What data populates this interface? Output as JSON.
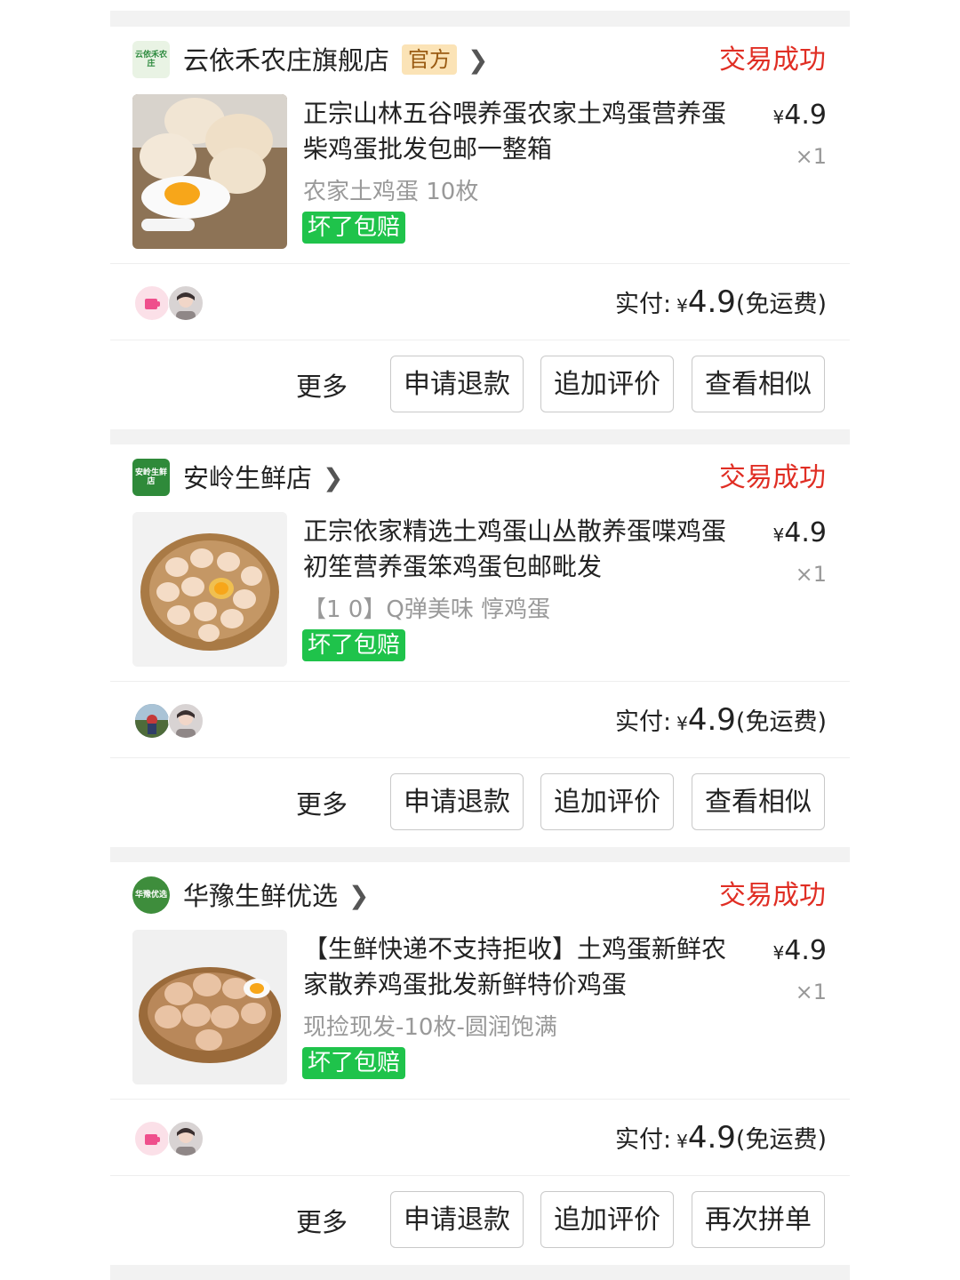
{
  "orders": [
    {
      "shop": {
        "name": "云依禾农庄旗舰店",
        "badge": "官方",
        "logo_text": "云依禾农庄",
        "logo_color": "#e9f3e4",
        "logo_text_color": "#2d8a3e"
      },
      "status": "交易成功",
      "title": "正宗山林五谷喂养蛋农家土鸡蛋营养蛋柴鸡蛋批发包邮一整箱",
      "spec": "农家土鸡蛋 10枚",
      "guarantee": "坏了包赔",
      "price_symbol": "¥",
      "price": "4.9",
      "qty": "×1",
      "paid_label": "实付:",
      "paid_symbol": "¥",
      "paid_amount": "4.9",
      "shipping": "(免运费)",
      "more": "更多",
      "buttons": [
        "申请退款",
        "追加评价",
        "查看相似"
      ]
    },
    {
      "shop": {
        "name": "安岭生鲜店",
        "logo_text": "安岭生鲜店",
        "logo_color": "#2f8a3a",
        "logo_text_color": "#ffffff"
      },
      "status": "交易成功",
      "title": "正宗依家精选土鸡蛋山丛散养蛋喋鸡蛋初笙营养蛋笨鸡蛋包邮毗发",
      "spec": "【1 0】Q弹美味 惇鸡蛋",
      "guarantee": "坏了包赔",
      "price_symbol": "¥",
      "price": "4.9",
      "qty": "×1",
      "paid_label": "实付:",
      "paid_symbol": "¥",
      "paid_amount": "4.9",
      "shipping": "(免运费)",
      "more": "更多",
      "buttons": [
        "申请退款",
        "追加评价",
        "查看相似"
      ]
    },
    {
      "shop": {
        "name": "华豫生鲜优选",
        "logo_text": "华豫优选",
        "logo_color": "#3e8d3c",
        "logo_text_color": "#ffffff"
      },
      "status": "交易成功",
      "title": "【生鲜快递不支持拒收】土鸡蛋新鲜农家散养鸡蛋批发新鲜特价鸡蛋",
      "spec": "现捡现发-10枚-圆润饱满",
      "guarantee": "坏了包赔",
      "price_symbol": "¥",
      "price": "4.9",
      "qty": "×1",
      "paid_label": "实付:",
      "paid_symbol": "¥",
      "paid_amount": "4.9",
      "shipping": "(免运费)",
      "more": "更多",
      "buttons": [
        "申请退款",
        "追加评价",
        "再次拼单"
      ]
    }
  ],
  "colors": {
    "status_red": "#e02e24",
    "guarantee_green": "#1fc34b",
    "badge_bg": "#fbe3b6",
    "badge_text": "#9a5b13"
  }
}
